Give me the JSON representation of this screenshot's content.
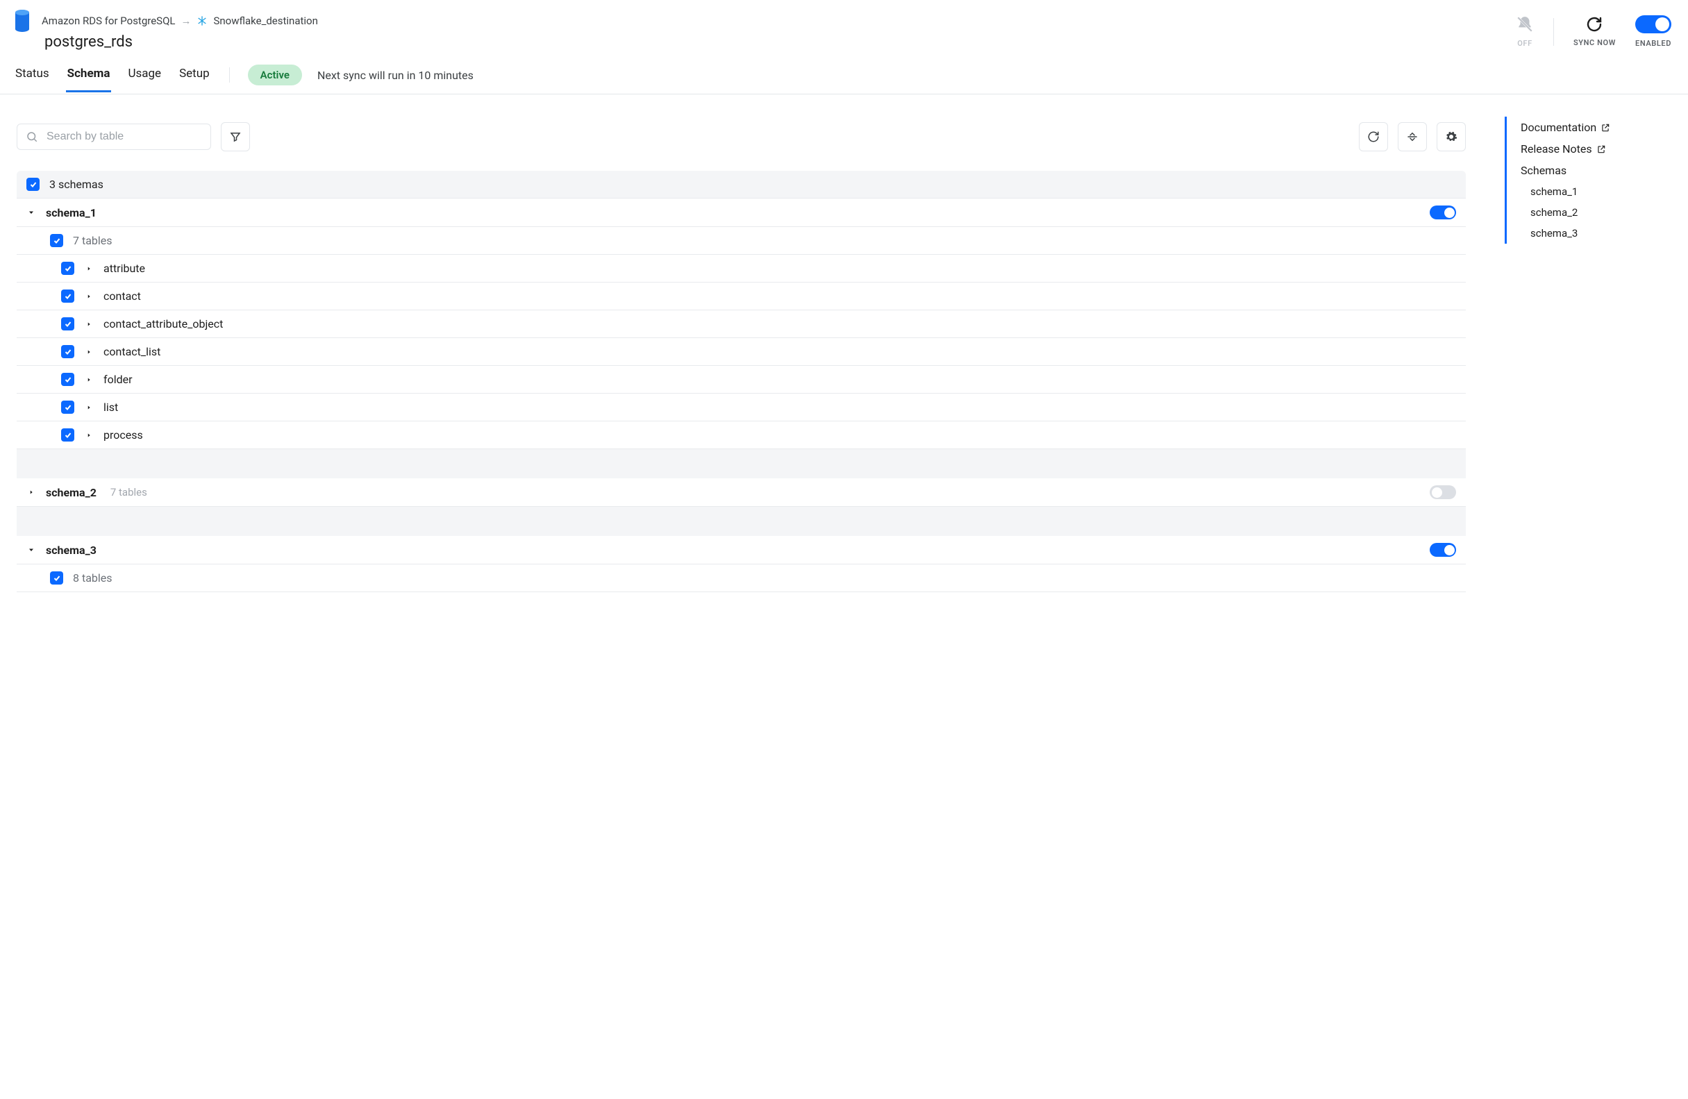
{
  "header": {
    "breadcrumb_source": "Amazon RDS for PostgreSQL",
    "breadcrumb_dest": "Snowflake_destination",
    "title": "postgres_rds",
    "tabs": [
      {
        "label": "Status",
        "active": false
      },
      {
        "label": "Schema",
        "active": true
      },
      {
        "label": "Usage",
        "active": false
      },
      {
        "label": "Setup",
        "active": false
      }
    ],
    "status_badge": "Active",
    "next_sync": "Next sync will run in 10 minutes",
    "actions": {
      "notifications_label": "OFF",
      "sync_now_label": "SYNC NOW",
      "enabled_label": "ENABLED"
    }
  },
  "toolbar": {
    "search_placeholder": "Search by table"
  },
  "summary": {
    "schema_count_label": "3 schemas"
  },
  "schemas": [
    {
      "name": "schema_1",
      "expanded": true,
      "enabled": true,
      "tables_label": "7 tables",
      "tables": [
        "attribute",
        "contact",
        "contact_attribute_object",
        "contact_list",
        "folder",
        "list",
        "process"
      ]
    },
    {
      "name": "schema_2",
      "expanded": false,
      "enabled": false,
      "tables_label": "7 tables",
      "tables": []
    },
    {
      "name": "schema_3",
      "expanded": true,
      "enabled": true,
      "tables_label": "8 tables",
      "tables": []
    }
  ],
  "side": {
    "documentation": "Documentation",
    "release_notes": "Release Notes",
    "schemas_section": "Schemas",
    "schema_links": [
      "schema_1",
      "schema_2",
      "schema_3"
    ]
  }
}
